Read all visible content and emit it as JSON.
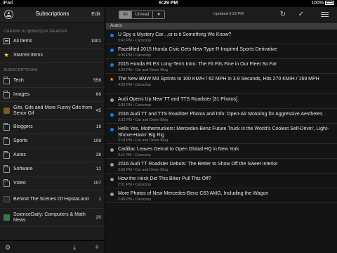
{
  "status": {
    "carrier": "iPad",
    "time": "6:29 PM",
    "battery": "100%"
  },
  "sidebar": {
    "title": "Subscriptions",
    "edit_label": "Edit",
    "account_label": "CHEBINLIU @BAZQUX READER",
    "top_items": [
      {
        "label": "All Items",
        "count": "1901",
        "icon": "all-items-icon"
      },
      {
        "label": "Starred Items",
        "count": "",
        "icon": "star-icon"
      }
    ],
    "subs_label": "SUBSCRIPTIONS",
    "items": [
      {
        "label": "Tech",
        "count": "556",
        "icon": "folder-icon"
      },
      {
        "label": "Images",
        "count": "66",
        "icon": "folder-icon"
      },
      {
        "label": "Gifs, Gifs and More Funny Gifs from Senor Gif",
        "count": "45",
        "icon": "feed-icon"
      },
      {
        "label": "Bloggers",
        "count": "18",
        "icon": "folder-icon"
      },
      {
        "label": "Sports",
        "count": "108",
        "icon": "folder-icon"
      },
      {
        "label": "Autos",
        "count": "38",
        "icon": "folder-icon"
      },
      {
        "label": "Software",
        "count": "12",
        "icon": "folder-icon"
      },
      {
        "label": "Video",
        "count": "107",
        "icon": "folder-icon"
      },
      {
        "label": "Behind The Scenes Of HipstaLand",
        "count": "1",
        "icon": "feed-icon"
      },
      {
        "label": "ScienceDaily: Computers & Math News",
        "count": "20",
        "icon": "feed-icon"
      }
    ],
    "footer": {
      "settings": "gear-icon",
      "import": "import-icon",
      "add": "add-icon"
    }
  },
  "toolbar": {
    "filters": [
      "All",
      "Unread",
      "★"
    ],
    "active_filter": "All",
    "updated": "Updated 6:29 PM"
  },
  "section": "Autos",
  "articles": [
    {
      "title": "U Spy a Mystery Car…or is it Something We Know?",
      "meta": "5:42 PM • Carscoop",
      "state": "unread"
    },
    {
      "title": "Facelifted 2015 Honda Civic Gets New Type R-Inspired Sports Derivative",
      "meta": "4:30 PM • Carscoop",
      "state": "unread"
    },
    {
      "title": "2015 Honda Fit EX Long-Term Intro: The Fit Fits Fine in Our Fleet So Far",
      "meta": "4:20 PM • Car and Driver Blog",
      "state": "unread"
    },
    {
      "title": "The New BMW M3 Sprints to 100 KM/H / 62 MPH in 3.9 Seconds, Hits 270 KM/H / 169 MPH",
      "meta": "4:05 PM • Carscoop",
      "state": "starred"
    },
    {
      "title": "Audi Opens Up New TT and TTS Roadster [31 Photos]",
      "meta": "3:36 PM • Carscoop",
      "state": "read"
    },
    {
      "title": "2016 Audi TT and TTS Roadster Photos and Info: Open-Air Motoring for Aggressive Aesthetes",
      "meta": "3:32 PM • Car and Driver Blog",
      "state": "unread"
    },
    {
      "title": "Hells Yes, Mothertruckers: Mercedes-Benz Future Truck Is the World's Coolest Self-Drivin', Light-Shove-Havin' Big Rig",
      "meta": "3:18 PM • Car and Driver Blog",
      "state": "unread"
    },
    {
      "title": "Cadillac Leaves Detroit to Open Global HQ in New York",
      "meta": "3:11 PM • Carscoop",
      "state": "read"
    },
    {
      "title": "2016 Audi TT Roadster Debuts: The Better to Show Off the Sweet Interior",
      "meta": "3:00 PM • Car and Driver Blog",
      "state": "read"
    },
    {
      "title": "How the Heck Did This Biker Pull This Off?",
      "meta": "2:51 PM • Carscoop",
      "state": "read"
    },
    {
      "title": "More Photos of New Mercedes-Benz C63 AMG, Including the Wagon",
      "meta": "2:45 PM • Carscoop",
      "state": "read"
    }
  ]
}
